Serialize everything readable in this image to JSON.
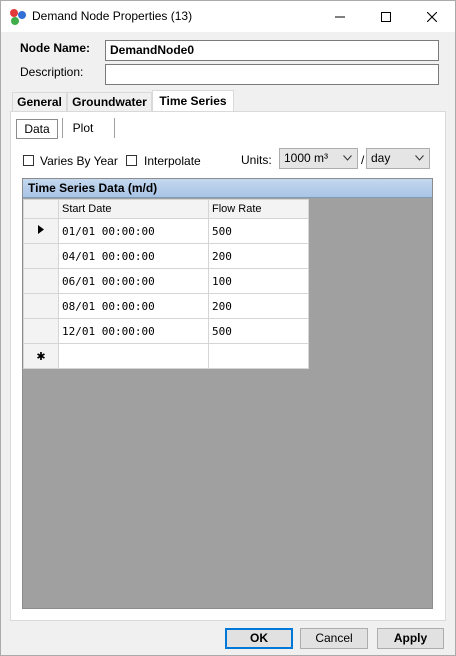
{
  "window": {
    "title": "Demand Node Properties (13)"
  },
  "form": {
    "node_name_label": "Node Name:",
    "node_name_value": "DemandNode0",
    "description_label": "Description:",
    "description_value": ""
  },
  "tabs": [
    {
      "label": "General",
      "active": false
    },
    {
      "label": "Groundwater",
      "active": false
    },
    {
      "label": "Time Series",
      "active": true
    }
  ],
  "subtabs": [
    {
      "label": "Data",
      "active": true
    },
    {
      "label": "Plot",
      "active": false
    }
  ],
  "options": {
    "varies_by_year_label": "Varies By Year",
    "varies_by_year_checked": false,
    "interpolate_label": "Interpolate",
    "interpolate_checked": false,
    "units_label": "Units:",
    "units_volume": "1000 m³",
    "units_separator": "/",
    "units_time": "day"
  },
  "grid": {
    "caption": "Time Series Data (m/d)",
    "columns": [
      "Start Date",
      "Flow Rate"
    ],
    "rows": [
      {
        "marker": "current",
        "start_date": "01/01 00:00:00",
        "flow_rate": "500"
      },
      {
        "marker": "",
        "start_date": "04/01 00:00:00",
        "flow_rate": "200"
      },
      {
        "marker": "",
        "start_date": "06/01 00:00:00",
        "flow_rate": "100"
      },
      {
        "marker": "",
        "start_date": "08/01 00:00:00",
        "flow_rate": "200"
      },
      {
        "marker": "",
        "start_date": "12/01 00:00:00",
        "flow_rate": "500"
      }
    ],
    "new_row_marker": "✱"
  },
  "buttons": {
    "ok": "OK",
    "cancel": "Cancel",
    "apply": "Apply"
  },
  "colors": {
    "accent": "#0078d7",
    "grid_caption": "#b4cce9",
    "grid_background": "#a0a0a0"
  }
}
